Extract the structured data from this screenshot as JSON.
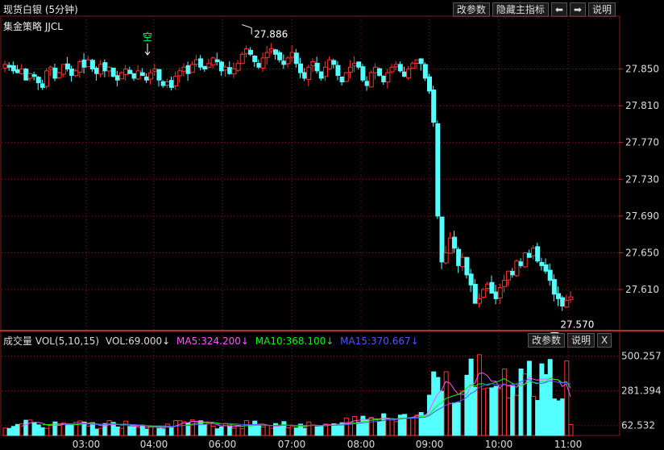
{
  "header": {
    "title": "现货白银 (5分钟)",
    "strategy": "集金策略 JJCL",
    "buttons": {
      "change_params": "改参数",
      "hide_indicator": "隐藏主指标",
      "left": "⬅",
      "right": "➡",
      "help": "说明"
    }
  },
  "volume_header": {
    "name": "成交量 VOL(5,10,15)",
    "vol": "VOL:69.000↓",
    "ma5": "MA5:324.200↓",
    "ma10": "MA10:368.100↓",
    "ma15": "MA15:370.667↓",
    "buttons": {
      "change_params": "改参数",
      "help": "说明",
      "close": "X"
    }
  },
  "annotations": {
    "high_label": "27.886",
    "low_label": "27.570",
    "signal": "空"
  },
  "colors": {
    "up": "#ff3232",
    "down": "#54ffff",
    "bg": "#000000",
    "grid": "#7a1e1e",
    "ma5": "#ff55ff",
    "ma10": "#00ff00",
    "ma15": "#5555ff"
  },
  "chart_data": [
    {
      "type": "candlestick",
      "title": "现货白银 (5分钟)",
      "y_ticks": [
        27.85,
        27.81,
        27.77,
        27.73,
        27.69,
        27.65,
        27.61
      ],
      "y_tick_labels": [
        "27.850",
        "27.810",
        "27.770",
        "27.730",
        "27.690",
        "27.650",
        "27.610"
      ],
      "ylim": [
        27.567,
        27.89
      ],
      "x_tick_labels": [
        "03:00",
        "04:00",
        "06:00",
        "07:00",
        "08:00",
        "09:00",
        "10:00",
        "11:00"
      ],
      "high": 27.886,
      "low": 27.57,
      "close_series": [
        27.855,
        27.852,
        27.848,
        27.846,
        27.85,
        27.838,
        27.845,
        27.842,
        27.835,
        27.83,
        27.848,
        27.852,
        27.84,
        27.846,
        27.855,
        27.85,
        27.843,
        27.848,
        27.858,
        27.852,
        27.86,
        27.85,
        27.845,
        27.855,
        27.848,
        27.852,
        27.842,
        27.838,
        27.846,
        27.85,
        27.845,
        27.84,
        27.848,
        27.843,
        27.838,
        27.846,
        27.85,
        27.838,
        27.832,
        27.836,
        27.83,
        27.842,
        27.848,
        27.852,
        27.845,
        27.855,
        27.86,
        27.852,
        27.85,
        27.856,
        27.862,
        27.858,
        27.848,
        27.852,
        27.845,
        27.85,
        27.856,
        27.866,
        27.872,
        27.866,
        27.858,
        27.852,
        27.862,
        27.868,
        27.872,
        27.866,
        27.86,
        27.855,
        27.862,
        27.868,
        27.856,
        27.846,
        27.84,
        27.852,
        27.858,
        27.848,
        27.84,
        27.852,
        27.86,
        27.855,
        27.843,
        27.836,
        27.846,
        27.852,
        27.856,
        27.852,
        27.838,
        27.832,
        27.846,
        27.852,
        27.843,
        27.836,
        27.846,
        27.852,
        27.855,
        27.848,
        27.842,
        27.85,
        27.856,
        27.86,
        27.856,
        27.84,
        27.826,
        27.792,
        27.69,
        27.64,
        27.65,
        27.666,
        27.655,
        27.636,
        27.645,
        27.626,
        27.615,
        27.595,
        27.6,
        27.61,
        27.616,
        27.606,
        27.6,
        27.612,
        27.62,
        27.63,
        27.626,
        27.641,
        27.636,
        27.65,
        27.645,
        27.655,
        27.641,
        27.636,
        27.63,
        27.62,
        27.605,
        27.6,
        27.592,
        27.598,
        27.602
      ],
      "volume": {
        "ylim": [
          0,
          560
        ],
        "y_tick_labels": [
          "500.257",
          "281.394",
          "62.532"
        ],
        "y_ticks": [
          500.257,
          281.394,
          62.532
        ],
        "last": 69.0,
        "ma5": 324.2,
        "ma10": 368.1,
        "ma15": 370.667
      }
    }
  ]
}
